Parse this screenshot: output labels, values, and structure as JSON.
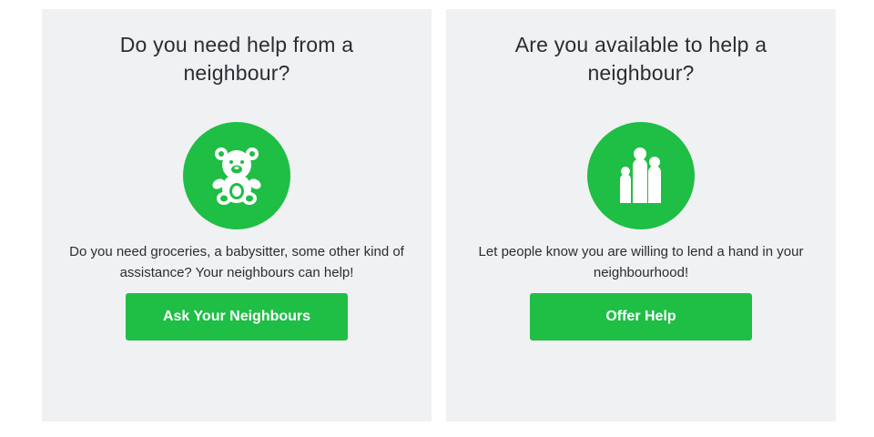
{
  "colors": {
    "card_background": "#f0f1f3",
    "accent_green": "#1fbe45",
    "text": "#2a2d33"
  },
  "need_help_card": {
    "title": "Do you need help from a neighbour?",
    "icon": "teddy-bear-icon",
    "description": "Do you need groceries, a babysitter, some other kind of assistance? Your neighbours can help!",
    "button_label": "Ask Your Neighbours"
  },
  "offer_help_card": {
    "title": "Are you available to help a neighbour?",
    "icon": "people-group-icon",
    "description": "Let people know you are willing to lend a hand in your neighbourhood!",
    "button_label": "Offer Help"
  }
}
